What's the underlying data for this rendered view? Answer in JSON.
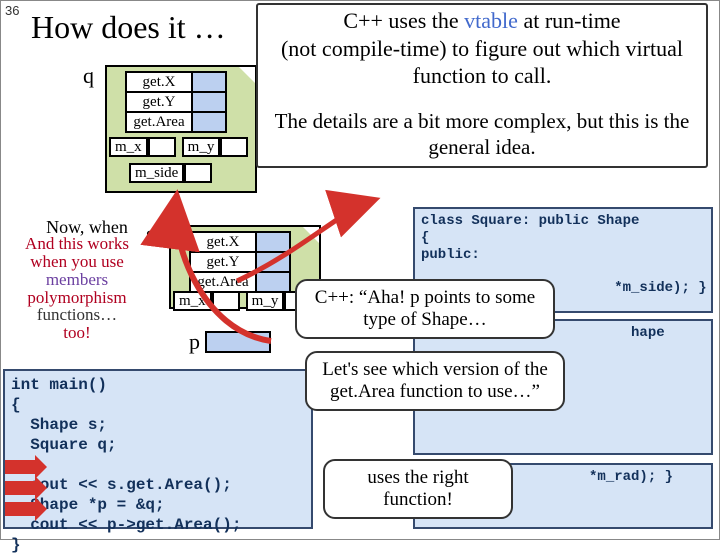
{
  "slideNumber": "36",
  "title": "How does it …",
  "callout": {
    "line1a": "C++ uses the ",
    "line1b": "vtable",
    "line1c": " at run-time",
    "line2": "(not compile-time) to figure out which virtual function to call.",
    "line3": "The details are a bit more complex, but this is the general idea."
  },
  "objects": {
    "q": {
      "label": "q",
      "vtable": [
        "get.X",
        "get.Y",
        "get.Area"
      ],
      "members": [
        "m_x",
        "m_y",
        "m_side"
      ]
    },
    "s": {
      "label": "s",
      "vtable": [
        "get.X",
        "get.Y",
        "get.Area"
      ],
      "members": [
        "m_x",
        "m_y"
      ]
    },
    "p": {
      "label": "p"
    }
  },
  "narrative": {
    "l1": "Now, when",
    "l2": "And this works",
    "l3": "when you use",
    "l4": "members",
    "l5": "polymorphism",
    "l6": "functions…",
    "l7": "too!"
  },
  "code": {
    "l1": "int main()",
    "l2": "{",
    "l3": "  Shape s;",
    "l4": "  Square q;",
    "l5": "  cout << s.get.Area();",
    "l6": "  Shape *p = &q;",
    "l7": "  cout << p->get.Area();",
    "l8": "}"
  },
  "classes": {
    "square": {
      "l1": "class Square: public Shape",
      "l2": "{",
      "l3": "public:",
      "l4": "",
      "l5": "                       *m_side); }"
    },
    "circle": {
      "l1": "                         hape",
      "l2": "",
      "l3": "                    *m_rad); }",
      "l4": "};"
    }
  },
  "midCallouts": {
    "c1": "C++: “Aha! p points to some type of Shape…",
    "c2": "Let's see which version of the get.Area function to use…”",
    "c3": "uses the right function!"
  }
}
